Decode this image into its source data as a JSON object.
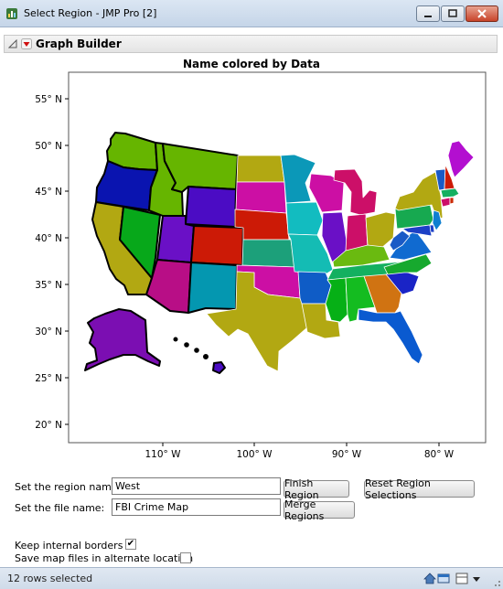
{
  "window": {
    "title": "Select Region - JMP Pro [2]"
  },
  "report": {
    "title": "Graph Builder"
  },
  "chart_data": {
    "type": "map",
    "title": "Name colored by Data",
    "xlabel": "",
    "ylabel": "",
    "x_ticks": [
      "110° W",
      "100° W",
      "90° W",
      "80° W"
    ],
    "y_ticks": [
      "55° N",
      "50° N",
      "45° N",
      "40° N",
      "35° N",
      "30° N",
      "25° N",
      "20° N"
    ],
    "xlim": [
      -118.5,
      -76
    ],
    "ylim": [
      19,
      56.5
    ],
    "regions": [
      {
        "name": "Washington",
        "color": "#66b500"
      },
      {
        "name": "Oregon",
        "color": "#0a14b0"
      },
      {
        "name": "California",
        "color": "#b2a812"
      },
      {
        "name": "Idaho",
        "color": "#66b500"
      },
      {
        "name": "Nevada",
        "color": "#07a81a"
      },
      {
        "name": "Montana",
        "color": "#66b500"
      },
      {
        "name": "Wyoming",
        "color": "#4b0cc4"
      },
      {
        "name": "Utah",
        "color": "#6a10c6"
      },
      {
        "name": "Colorado",
        "color": "#cc1a06"
      },
      {
        "name": "Arizona",
        "color": "#b80e86"
      },
      {
        "name": "New Mexico",
        "color": "#0497b0"
      },
      {
        "name": "Alaska",
        "color": "#7b0eb2"
      },
      {
        "name": "Hawaii",
        "color": "#4b0cc4"
      },
      {
        "name": "North Dakota",
        "color": "#b2a812"
      },
      {
        "name": "South Dakota",
        "color": "#cc0fa4"
      },
      {
        "name": "Nebraska",
        "color": "#cc1a06"
      },
      {
        "name": "Kansas",
        "color": "#1ca07a"
      },
      {
        "name": "Oklahoma",
        "color": "#cc0fa4"
      },
      {
        "name": "Texas",
        "color": "#b2a812"
      },
      {
        "name": "Minnesota",
        "color": "#0b98b8"
      },
      {
        "name": "Iowa",
        "color": "#12bcc0"
      },
      {
        "name": "Missouri",
        "color": "#14bcb4"
      },
      {
        "name": "Arkansas",
        "color": "#0f5cc6"
      },
      {
        "name": "Louisiana",
        "color": "#b2a812"
      },
      {
        "name": "Wisconsin",
        "color": "#cc0fa4"
      },
      {
        "name": "Illinois",
        "color": "#6a10c6"
      },
      {
        "name": "Michigan",
        "color": "#cc0f68"
      },
      {
        "name": "Indiana",
        "color": "#cc0f68"
      },
      {
        "name": "Ohio",
        "color": "#b2a812"
      },
      {
        "name": "Kentucky",
        "color": "#6aba10"
      },
      {
        "name": "Tennessee",
        "color": "#14b060"
      },
      {
        "name": "Mississippi",
        "color": "#06b016"
      },
      {
        "name": "Alabama",
        "color": "#14bc20"
      },
      {
        "name": "Georgia",
        "color": "#d07312"
      },
      {
        "name": "Florida",
        "color": "#0a5ad0"
      },
      {
        "name": "South Carolina",
        "color": "#1a24c6"
      },
      {
        "name": "North Carolina",
        "color": "#17a92e"
      },
      {
        "name": "Virginia",
        "color": "#106ad0"
      },
      {
        "name": "West Virginia",
        "color": "#1a5ac6"
      },
      {
        "name": "Pennsylvania",
        "color": "#17a950"
      },
      {
        "name": "New York",
        "color": "#b2a812"
      },
      {
        "name": "Maryland",
        "color": "#1c40c6"
      },
      {
        "name": "New Jersey",
        "color": "#0e7fd0"
      },
      {
        "name": "Delaware",
        "color": "#1c40c6"
      },
      {
        "name": "Connecticut",
        "color": "#cc0f68"
      },
      {
        "name": "Rhode Island",
        "color": "#cc2a06"
      },
      {
        "name": "Massachusetts",
        "color": "#14b060"
      },
      {
        "name": "Vermont",
        "color": "#1a5ac6"
      },
      {
        "name": "New Hampshire",
        "color": "#cc1a06"
      },
      {
        "name": "Maine",
        "color": "#b30fd0"
      }
    ]
  },
  "form": {
    "region_label": "Set the region name:",
    "region_value": "West",
    "finish_button": "Finish Region",
    "reset_button": "Reset Region Selections",
    "file_label": "Set the file name:",
    "file_value": "FBI Crime Map",
    "merge_button": "Merge Regions",
    "keep_borders_label": "Keep internal borders",
    "keep_borders_checked": true,
    "save_alt_label": "Save map files in alternate location",
    "save_alt_checked": false
  },
  "status": {
    "text": "12 rows selected"
  }
}
